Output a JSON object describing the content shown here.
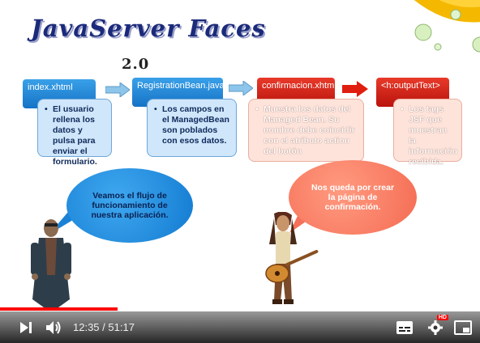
{
  "slide": {
    "title": "JavaServer Faces",
    "version": "2.0",
    "steps": [
      {
        "header": "index.xhtml",
        "body": "El usuario rellena los datos y pulsa para enviar el formulario."
      },
      {
        "header": "RegistrationBean.java",
        "body": "Los campos en el ManagedBean son poblados con esos datos."
      },
      {
        "header": "confirmacion.xhtml",
        "body": "Muestra los datos del Managed Bean. Su nombre debe coincidir con el atributo action del botón"
      },
      {
        "header": "<h:outputText>",
        "body": "Los tags JSF que muestran la información recibida."
      }
    ],
    "bubble_left": "Veamos el flujo de funcionamiento de nuestra aplicación.",
    "bubble_right": "Nos queda por crear la página de confirmación.",
    "bullet": "•"
  },
  "player": {
    "current_time": "12:35",
    "separator": "/",
    "duration": "51:17",
    "played_fraction": 0.245,
    "buffered_fraction": 0.3,
    "hd_badge": "HD",
    "colors": {
      "progress": "#ff0000",
      "hd": "#ff0000"
    }
  },
  "icons": [
    "next-icon",
    "volume-icon",
    "subtitles-icon",
    "settings-icon",
    "miniplayer-icon"
  ]
}
